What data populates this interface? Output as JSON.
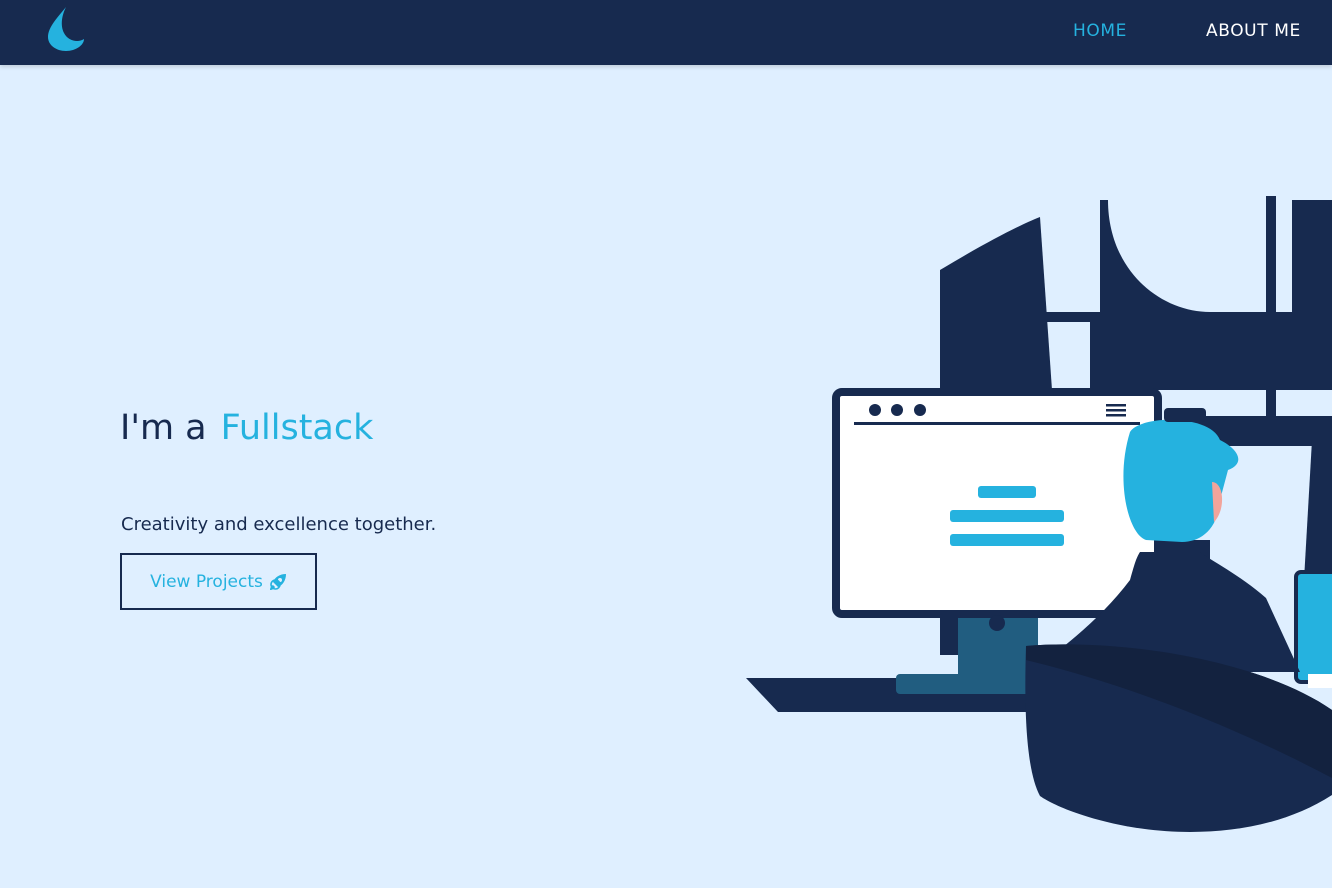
{
  "nav": {
    "logo_icon": "droplet-logo-icon",
    "links": [
      {
        "label": "HOME",
        "active": true
      },
      {
        "label": "ABOUT ME",
        "active": false
      }
    ]
  },
  "hero": {
    "title_prefix": "I'm a",
    "title_highlight": "Fullstack",
    "subtitle": "Creativity and excellence together.",
    "button_label": "View Projects",
    "button_icon": "rocket-icon"
  },
  "illustration": {
    "subject": "developer-at-computer-illustration"
  },
  "colors": {
    "background": "#dfefff",
    "navbar": "#172a4f",
    "accent": "#25b2df",
    "text": "#172a4f",
    "nav_text": "#ffffff"
  }
}
